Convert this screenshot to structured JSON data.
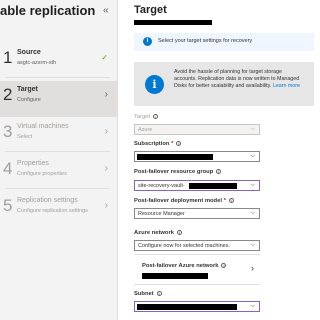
{
  "wizard": {
    "title": "able replication",
    "collapse_glyph": "«",
    "steps": [
      {
        "number": "1",
        "title": "Source",
        "subtitle": "asgtc-azsrm-sth",
        "state": "completed",
        "icon": "checkmark-icon"
      },
      {
        "number": "2",
        "title": "Target",
        "subtitle": "Configure",
        "state": "selected",
        "icon": "chevron-right-icon"
      },
      {
        "number": "3",
        "title": "Virtual machines",
        "subtitle": "Select",
        "state": "disabled",
        "icon": "chevron-right-icon"
      },
      {
        "number": "4",
        "title": "Properties",
        "subtitle": "Configure properties",
        "state": "disabled",
        "icon": "chevron-right-icon"
      },
      {
        "number": "5",
        "title": "Replication settings",
        "subtitle": "Configure replication settings",
        "state": "disabled",
        "icon": "chevron-right-icon"
      }
    ]
  },
  "target": {
    "title": "Target",
    "info_bar_text": "Select your target settings for recovery",
    "promo": {
      "text": "Avoid the hassle of planning for target storage accounts. Replication data is now written to Managed Disks for better scalability and availability.",
      "link": "Learn more"
    },
    "fields": {
      "target_label": "Target",
      "target_value": "Azure",
      "subscription_label": "Subscription",
      "subscription_value": "",
      "resource_group_label": "Post-failover resource group",
      "resource_group_value": "site-recovery-vault-",
      "deployment_model_label": "Post-failover deployment model",
      "deployment_model_value": "Resource Manager",
      "azure_network_label": "Azure network",
      "azure_network_value": "Configure now for selected machines.",
      "pf_network_label": "Post-failover Azure network",
      "subnet_label": "Subnet",
      "subnet_value": ""
    },
    "required_marker": "*",
    "info_glyph": "i"
  },
  "colors": {
    "accent": "#0078d4",
    "completed": "#57a300",
    "required": "#a4262c",
    "focus": "#8764b8"
  }
}
